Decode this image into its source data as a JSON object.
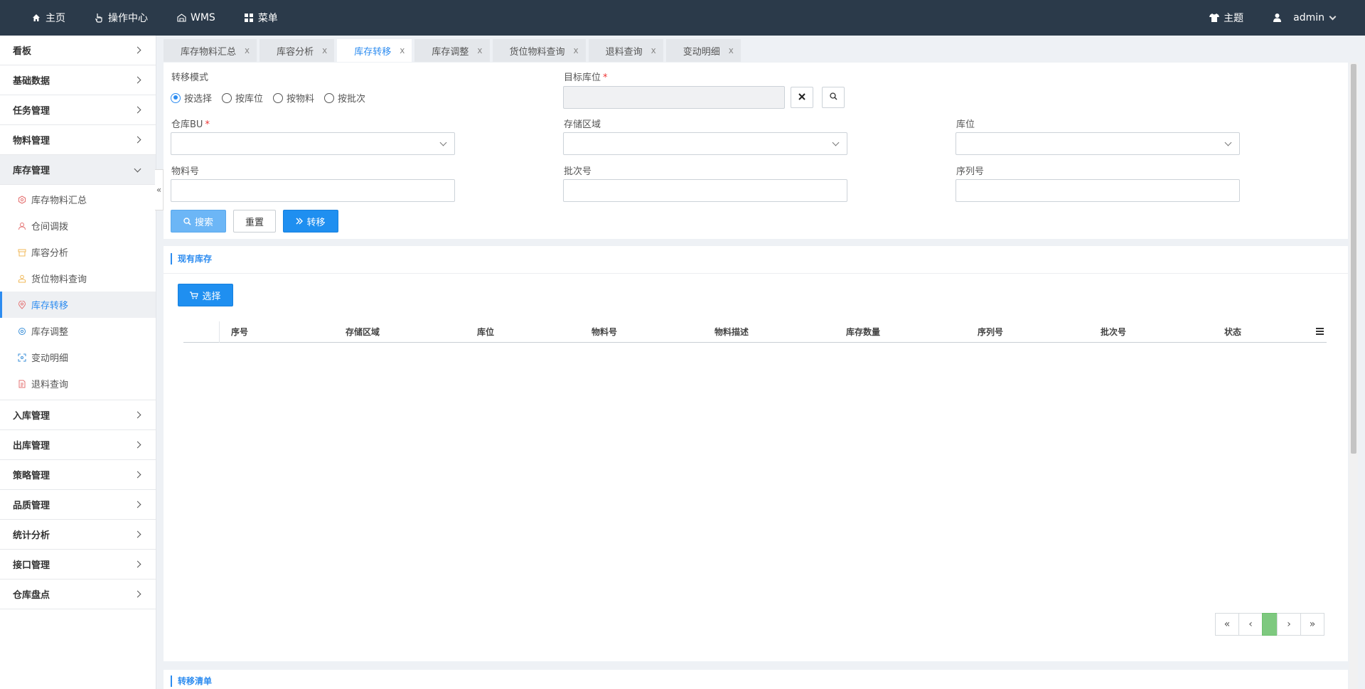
{
  "topnav": {
    "home": "主页",
    "ops_center": "操作中心",
    "wms": "WMS",
    "menu": "菜单",
    "theme": "主题",
    "user": "admin"
  },
  "sidebar": {
    "groups_top": [
      {
        "label": "看板"
      },
      {
        "label": "基础数据"
      },
      {
        "label": "任务管理"
      },
      {
        "label": "物料管理"
      }
    ],
    "open_group": "库存管理",
    "sub_items": [
      {
        "label": "库存物料汇总",
        "icon": "hexagon-icon"
      },
      {
        "label": "仓间调拨",
        "icon": "user-icon"
      },
      {
        "label": "库容分析",
        "icon": "box-icon"
      },
      {
        "label": "货位物料查询",
        "icon": "person-icon"
      },
      {
        "label": "库存转移",
        "icon": "location-icon"
      },
      {
        "label": "库存调整",
        "icon": "gear-icon"
      },
      {
        "label": "变动明细",
        "icon": "expand-icon"
      },
      {
        "label": "退料查询",
        "icon": "document-icon"
      }
    ],
    "groups_bottom": [
      {
        "label": "入库管理"
      },
      {
        "label": "出库管理"
      },
      {
        "label": "策略管理"
      },
      {
        "label": "品质管理"
      },
      {
        "label": "统计分析"
      },
      {
        "label": "接口管理"
      },
      {
        "label": "仓库盘点"
      }
    ]
  },
  "tabs": [
    {
      "label": "库存物料汇总"
    },
    {
      "label": "库容分析"
    },
    {
      "label": "库存转移"
    },
    {
      "label": "库存调整"
    },
    {
      "label": "货位物料查询"
    },
    {
      "label": "退料查询"
    },
    {
      "label": "变动明细"
    }
  ],
  "tab_close": "x",
  "form": {
    "mode_label": "转移模式",
    "modes": [
      "按选择",
      "按库位",
      "按物料",
      "按批次"
    ],
    "mode_selected": "按选择",
    "target_label": "目标库位",
    "required_mark": "*",
    "warehouse_label": "仓库BU",
    "area_label": "存储区域",
    "location_label": "库位",
    "material_label": "物料号",
    "batch_label": "批次号",
    "serial_label": "序列号",
    "search_btn": "搜索",
    "reset_btn": "重置",
    "transfer_btn": "转移"
  },
  "stock": {
    "title": "现有库存",
    "select_btn": "选择",
    "columns": [
      "序号",
      "存储区域",
      "库位",
      "物料号",
      "物料描述",
      "库存数量",
      "序列号",
      "批次号",
      "状态"
    ],
    "current_page": ""
  },
  "bottom": {
    "title": "转移清单"
  },
  "colors": {
    "topbar": "#2b3a4a",
    "accent": "#2d8cf0",
    "primary_button": "#1f8ff0",
    "pager_current": "#7ec97f"
  }
}
